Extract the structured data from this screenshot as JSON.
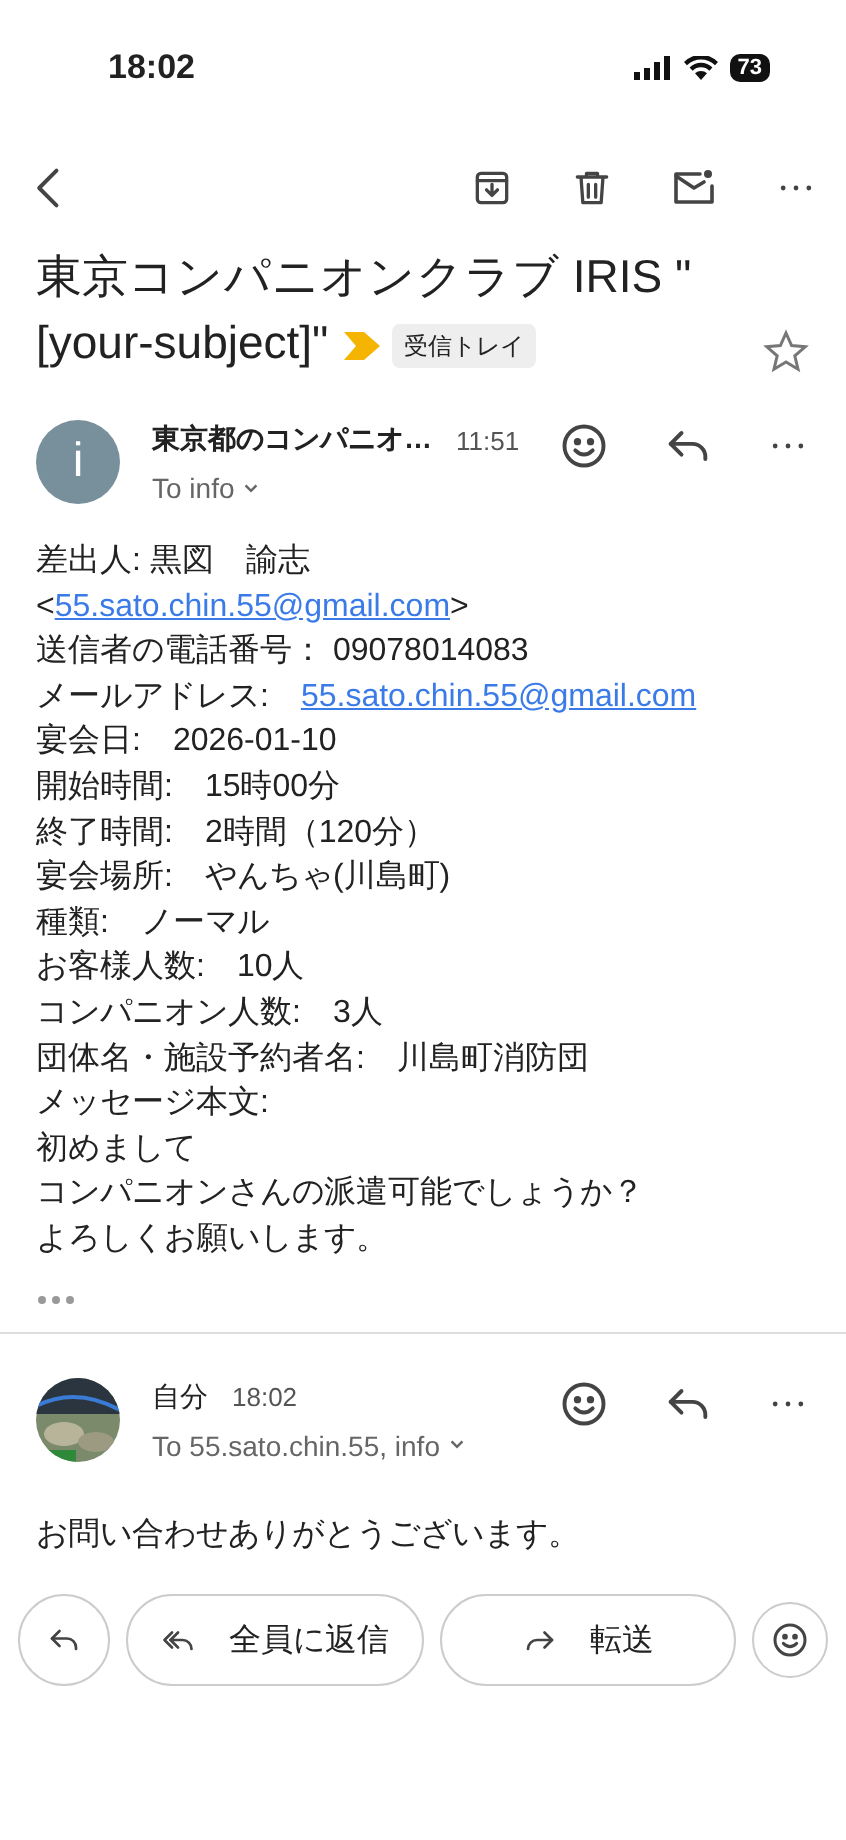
{
  "status_bar": {
    "time": "18:02",
    "battery": "73"
  },
  "subject": {
    "title": "東京コンパニオンクラブ IRIS \"[your-subject]\"",
    "label": "受信トレイ",
    "starred": false
  },
  "messages": [
    {
      "kind": "first",
      "avatar": {
        "kind": "letter",
        "letter": "i"
      },
      "sender": "東京都のコンパニオ…",
      "time": "11:51",
      "to": "To info",
      "lines": [
        {
          "parts": [
            {
              "kind": "text",
              "text": "差出人: 黒図　諭志"
            }
          ]
        },
        {
          "parts": [
            {
              "kind": "text",
              "text": "<"
            },
            {
              "kind": "link",
              "text": "55.sato.chin.55@gmail.com"
            },
            {
              "kind": "text",
              "text": ">"
            }
          ]
        },
        {
          "parts": [
            {
              "kind": "text",
              "text": "送信者の電話番号： 09078014083"
            }
          ]
        },
        {
          "parts": [
            {
              "kind": "text",
              "text": "メールアドレス:　"
            },
            {
              "kind": "link",
              "text": "55.sato.chin.55@gmail.com"
            }
          ]
        },
        {
          "parts": [
            {
              "kind": "text",
              "text": "宴会日:　2026-01-10"
            }
          ]
        },
        {
          "parts": [
            {
              "kind": "text",
              "text": "開始時間:　15時00分"
            }
          ]
        },
        {
          "parts": [
            {
              "kind": "text",
              "text": "終了時間:　2時間（120分）"
            }
          ]
        },
        {
          "parts": [
            {
              "kind": "text",
              "text": "宴会場所:　やんちゃ(川島町)"
            }
          ]
        },
        {
          "parts": [
            {
              "kind": "text",
              "text": "種類:　ノーマル"
            }
          ]
        },
        {
          "parts": [
            {
              "kind": "text",
              "text": "お客様人数:　10人"
            }
          ]
        },
        {
          "parts": [
            {
              "kind": "text",
              "text": "コンパニオン人数:　3人"
            }
          ]
        },
        {
          "parts": [
            {
              "kind": "text",
              "text": "団体名・施設予約者名:　川島町消防団"
            }
          ]
        },
        {
          "parts": [
            {
              "kind": "text",
              "text": "メッセージ本文:"
            }
          ]
        },
        {
          "parts": [
            {
              "kind": "text",
              "text": "初めまして"
            }
          ]
        },
        {
          "parts": [
            {
              "kind": "text",
              "text": "コンパニオンさんの派遣可能でしょうか？"
            }
          ]
        },
        {
          "parts": [
            {
              "kind": "text",
              "text": "よろしくお願いします。"
            }
          ]
        }
      ],
      "trimmed": true
    },
    {
      "kind": "reply",
      "avatar": {
        "kind": "picture"
      },
      "sender": "自分",
      "time": "18:02",
      "to": "To 55.sato.chin.55, info",
      "lines": [
        {
          "parts": [
            {
              "kind": "text",
              "text": "お問い合わせありがとうございます。"
            }
          ]
        }
      ],
      "trimmed": false
    }
  ],
  "actions": [
    {
      "kind": "reply"
    },
    {
      "kind": "reply_all",
      "label": "全員に返信"
    },
    {
      "kind": "forward",
      "label": "転送"
    },
    {
      "kind": "emoji"
    }
  ]
}
